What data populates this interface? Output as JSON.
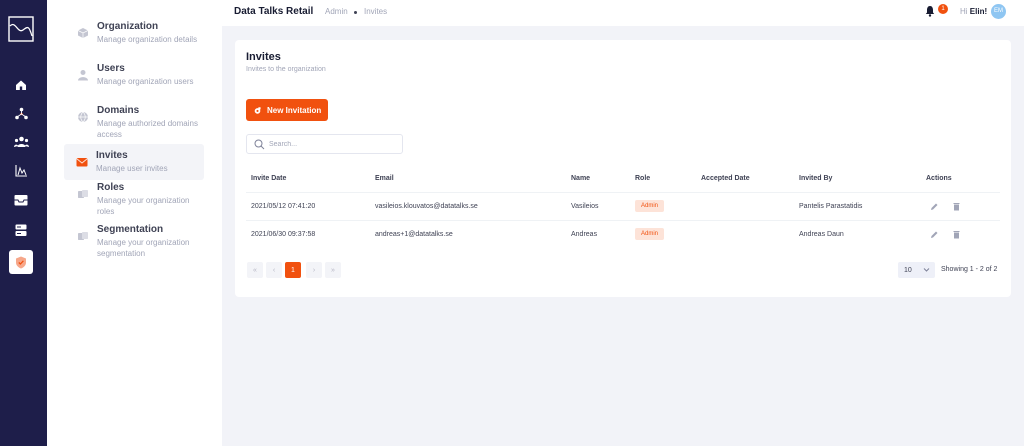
{
  "header": {
    "app_title": "Data Talks Retail",
    "breadcrumb": [
      "Admin",
      "Invites"
    ],
    "notification_count": "1",
    "greeting_prefix": "Hi",
    "user_name": "Elin!",
    "avatar_initials": "EM"
  },
  "rail": {
    "icons": [
      "logo-chart-icon",
      "home-icon",
      "sitemap-icon",
      "users-icon",
      "analytics-icon",
      "inbox-icon",
      "server-icon",
      "shield-icon"
    ],
    "active": "shield-icon"
  },
  "menu": {
    "items": [
      {
        "title": "Organization",
        "desc": "Manage organization details",
        "icon": "cube-icon"
      },
      {
        "title": "Users",
        "desc": "Manage organization users",
        "icon": "user-icon"
      },
      {
        "title": "Domains",
        "desc": "Manage authorized domains access",
        "icon": "globe-icon"
      },
      {
        "title": "Invites",
        "desc": "Manage user invites",
        "icon": "envelope-icon",
        "active": true
      },
      {
        "title": "Roles",
        "desc": "Manage your organization roles",
        "icon": "cards-icon"
      },
      {
        "title": "Segmentation",
        "desc": "Manage your organization segmentation",
        "icon": "cards-icon"
      }
    ]
  },
  "card": {
    "title": "Invites",
    "subtitle": "Invites to the organization",
    "new_button_label": "New Invitation",
    "search_placeholder": "Search..."
  },
  "table": {
    "columns": [
      "Invite Date",
      "Email",
      "Name",
      "Role",
      "Accepted Date",
      "Invited By",
      "Actions"
    ],
    "rows": [
      {
        "invite_date": "2021/05/12 07:41:20",
        "email": "vasileios.klouvatos@datatalks.se",
        "name": "Vasileios",
        "role": "Admin",
        "accepted_date": "",
        "invited_by": "Pantelis Parastatidis"
      },
      {
        "invite_date": "2021/06/30 09:37:58",
        "email": "andreas+1@datatalks.se",
        "name": "Andreas",
        "role": "Admin",
        "accepted_date": "",
        "invited_by": "Andreas Daun"
      }
    ]
  },
  "pagination": {
    "first": "«",
    "prev": "‹",
    "current_page": "1",
    "next": "›",
    "last": "»",
    "page_size": "10",
    "showing_text": "Showing 1 - 2 of 2"
  },
  "colors": {
    "accent": "#f1510f",
    "rail_bg": "#1e1e4a",
    "badge_bg": "#fde3d8"
  }
}
